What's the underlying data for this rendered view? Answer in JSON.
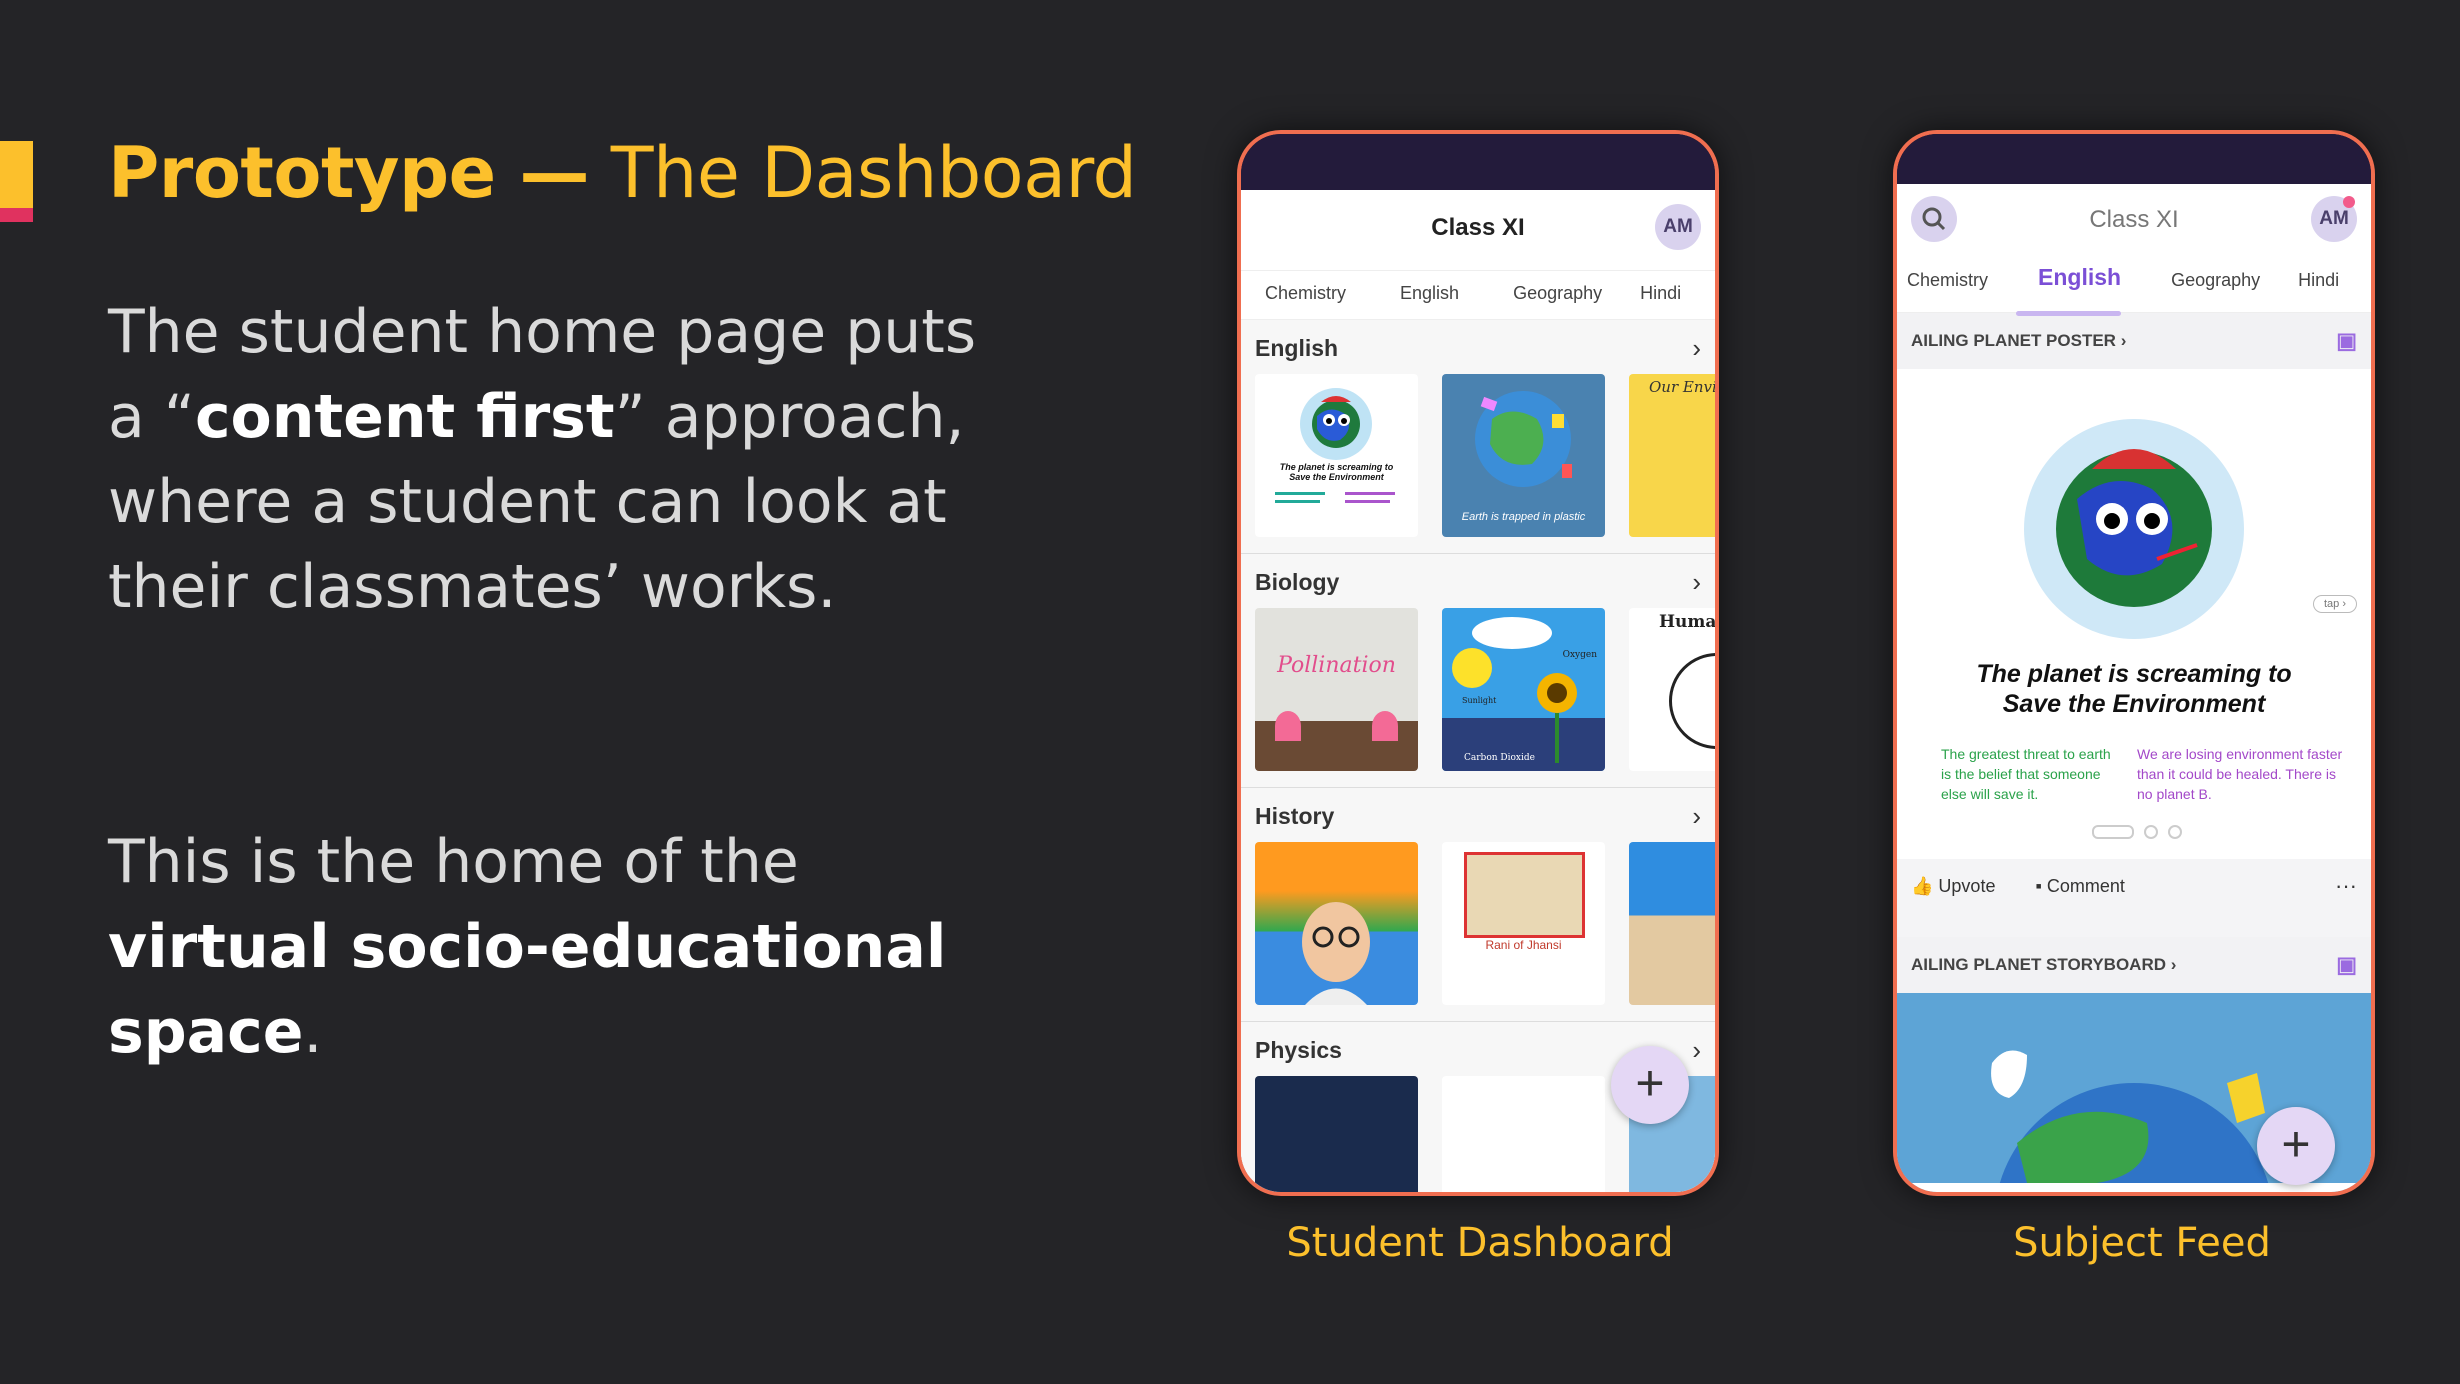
{
  "slide": {
    "title_bold": "Prototype —",
    "title_rest": " The Dashboard",
    "p1_a": "The student home page puts a “",
    "p1_bold": "content first",
    "p1_b": "” approach, where a student can look at their classmates’ works.",
    "p2_a": "This is the home of the ",
    "p2_bold": "virtual socio-educational space",
    "p2_b": "."
  },
  "dashboard": {
    "caption": "Student Dashboard",
    "app_title": "Class XI",
    "avatar": "AM",
    "tabs": [
      "Chemistry",
      "English",
      "Geography",
      "Hindi"
    ],
    "sections": [
      {
        "title": "English"
      },
      {
        "title": "Biology"
      },
      {
        "title": "History"
      },
      {
        "title": "Physics"
      }
    ],
    "thumb_text": {
      "planet": "The planet is screaming to Save the Environment",
      "plastic": "Earth is trapped in plastic",
      "pollination": "Pollination",
      "oxygen": "Oxygen",
      "sunlight": "Sunlight",
      "co2": "Carbon Dioxide",
      "human": "Huma",
      "rani": "Rani of Jhansi",
      "our_env": "Our Envi"
    },
    "fab": "+"
  },
  "feed": {
    "caption": "Subject Feed",
    "app_title": "Class XI",
    "avatar": "AM",
    "tabs": [
      "Chemistry",
      "English",
      "Geography",
      "Hindi"
    ],
    "active_tab": "English",
    "post1_title": "AILING PLANET POSTER",
    "post1_heading": "The planet is screaming to Save the Environment",
    "post1_left": "The greatest threat to earth is the belief that someone else will save it.",
    "post1_right": "We are losing environment faster than it could be healed. There is no planet B.",
    "tap": "tap",
    "upvote": "Upvote",
    "comment": "Comment",
    "more": "···",
    "post2_title": "AILING PLANET STORYBOARD",
    "fab": "+"
  }
}
